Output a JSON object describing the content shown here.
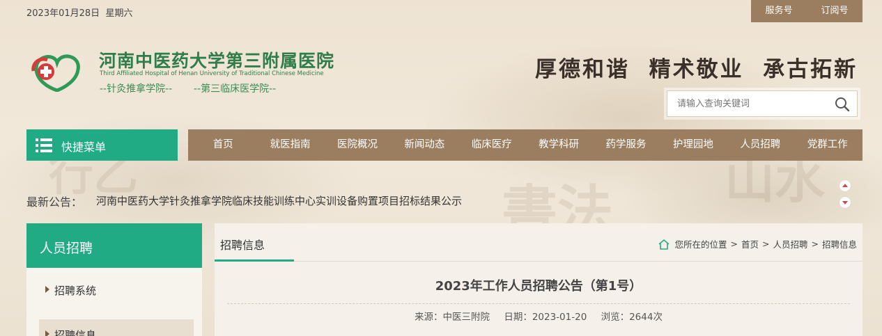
{
  "topbar": {
    "date": "2023年01月28日",
    "weekday": "星期六",
    "links": [
      "服务号",
      "订阅号"
    ]
  },
  "header": {
    "hospital_name_cn": "河南中医药大学第三附属医院",
    "hospital_name_en": "Third Affiliated Hospital of Henan University of Traditional Chinese Medicine",
    "sub_name_1": "--针灸推拿学院--",
    "sub_name_2": "--第三临床医学院--",
    "slogan": "厚德和谐  精术敬业  承古拓新",
    "search_placeholder": "请输入查询关键词"
  },
  "nav": {
    "quick_menu": "快捷菜单",
    "items": [
      "首页",
      "就医指南",
      "医院概况",
      "新闻动态",
      "临床医疗",
      "教学科研",
      "药学服务",
      "护理园地",
      "人员招聘",
      "党群工作"
    ]
  },
  "notice": {
    "label": "最新公告：",
    "text": "河南中医药大学针灸推拿学院临床技能训练中心实训设备购置项目招标结果公示"
  },
  "sidebar": {
    "title": "人员招聘",
    "items": [
      "招聘系统",
      "招聘信息"
    ]
  },
  "main": {
    "tab": "招聘信息",
    "breadcrumb": [
      "您所在的位置",
      "首页",
      "人员招聘",
      "招聘信息"
    ],
    "article": {
      "title": "2023年工作人员招聘公告（第1号）",
      "source": "来源：中医三附院",
      "date": "日期：2023-01-20",
      "views": "浏览：2644次"
    }
  },
  "colors": {
    "green": "#21ab84",
    "brown": "#9a7e5f",
    "logo_red": "#d63a3a",
    "logo_green": "#2f9a55"
  },
  "icons": [
    "logo-icon",
    "search-icon",
    "menu-list-icon",
    "arrow-up-icon",
    "arrow-down-icon",
    "home-icon"
  ]
}
